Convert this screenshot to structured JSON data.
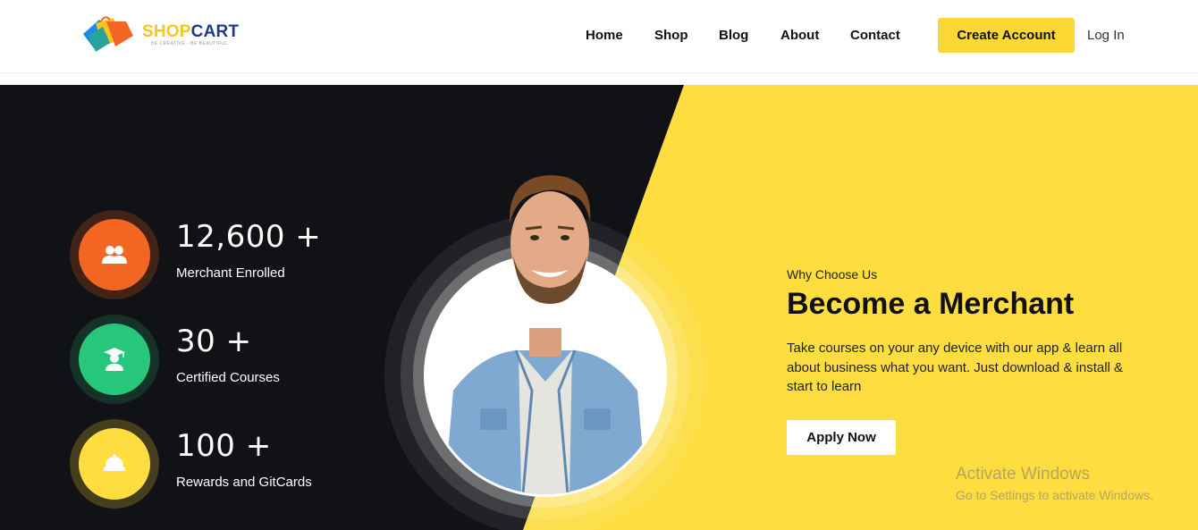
{
  "brand": {
    "name_part1": "SHOP",
    "name_part2": "CART",
    "tagline": "BE CREATIVE · BE BEAUTIFUL"
  },
  "nav": {
    "items": [
      {
        "label": "Home"
      },
      {
        "label": "Shop"
      },
      {
        "label": "Blog"
      },
      {
        "label": "About"
      },
      {
        "label": "Contact"
      }
    ],
    "create_account": "Create Account",
    "login": "Log In"
  },
  "stats": [
    {
      "value": "12,600 +",
      "label": "Merchant Enrolled",
      "color": "#f26522",
      "icon": "users-icon"
    },
    {
      "value": "30 +",
      "label": "Certified Courses",
      "color": "#26c77a",
      "icon": "graduate-icon"
    },
    {
      "value": "100 +",
      "label": "Rewards and GitCards",
      "color": "#fdd835",
      "icon": "gift-icon"
    }
  ],
  "hero": {
    "eyebrow": "Why Choose Us",
    "title": "Become a Merchant",
    "description": "Take courses on your any device with our app & learn all about business what you want. Just download & install & start to learn",
    "cta": "Apply Now"
  },
  "watermark": {
    "line1": "Activate Windows",
    "line2": "Go to Settings to activate Windows."
  },
  "colors": {
    "dark": "#111215",
    "accent": "#fdd835"
  }
}
